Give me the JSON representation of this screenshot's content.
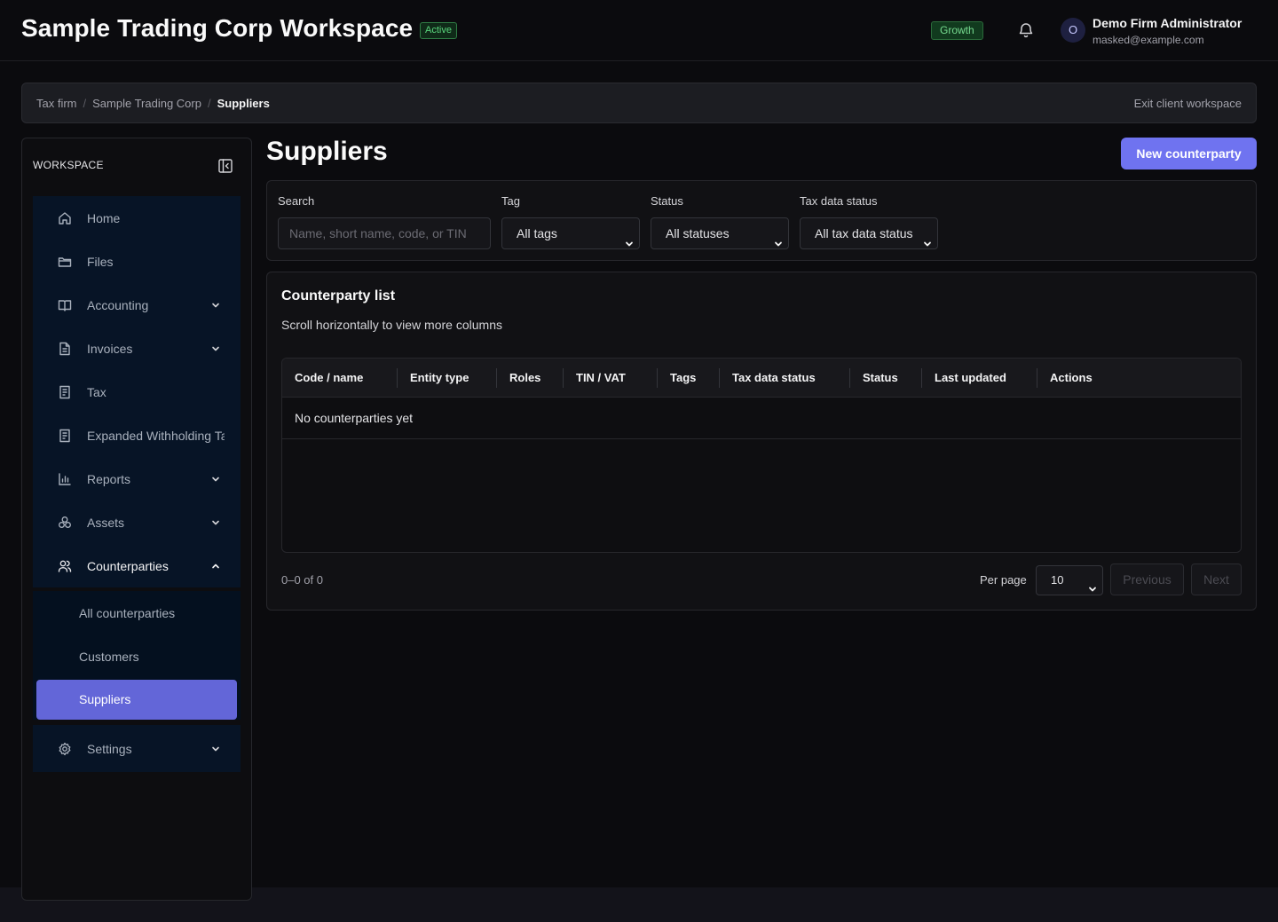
{
  "header": {
    "workspace_title": "Sample Trading Corp Workspace",
    "status_badge": "Active",
    "plan_badge": "Growth",
    "user": {
      "avatar_initial": "O",
      "name": "Demo Firm Administrator",
      "email": "masked@example.com"
    },
    "colors": {
      "status_badge": "#5ad67d",
      "plan_badge": "#76d98f"
    }
  },
  "breadcrumb": {
    "items": [
      "Tax firm",
      "Sample Trading Corp",
      "Suppliers"
    ],
    "separator": "/",
    "exit_label": "Exit client workspace"
  },
  "sidebar": {
    "heading": "WORKSPACE",
    "items": [
      {
        "label": "Home",
        "icon": "home-icon"
      },
      {
        "label": "Files",
        "icon": "folder-icon"
      },
      {
        "label": "Accounting",
        "icon": "book-icon",
        "has_children": true
      },
      {
        "label": "Invoices",
        "icon": "document-icon",
        "has_children": true
      },
      {
        "label": "Tax",
        "icon": "receipt-icon"
      },
      {
        "label": "Expanded Withholding Tax",
        "icon": "receipt-icon"
      },
      {
        "label": "Reports",
        "icon": "bar-chart-icon",
        "has_children": true
      },
      {
        "label": "Assets",
        "icon": "cubes-icon",
        "has_children": true
      },
      {
        "label": "Counterparties",
        "icon": "users-icon",
        "has_children": true,
        "expanded": true
      },
      {
        "label": "Settings",
        "icon": "gear-icon",
        "has_children": true
      }
    ],
    "counterparties_children": [
      {
        "label": "All counterparties"
      },
      {
        "label": "Customers"
      },
      {
        "label": "Suppliers",
        "active": true
      }
    ],
    "colors": {
      "active": "#6366d8"
    }
  },
  "main": {
    "title": "Suppliers",
    "new_button": "New counterparty",
    "filters": {
      "search": {
        "label": "Search",
        "placeholder": "Name, short name, code, or TIN",
        "value": ""
      },
      "tag": {
        "label": "Tag",
        "value": "All tags"
      },
      "status": {
        "label": "Status",
        "value": "All statuses"
      },
      "tax_status": {
        "label": "Tax data status",
        "value": "All tax data status"
      }
    },
    "list": {
      "title": "Counterparty list",
      "hint": "Scroll horizontally to view more columns",
      "columns": [
        "Code / name",
        "Entity type",
        "Roles",
        "TIN / VAT",
        "Tags",
        "Tax data status",
        "Status",
        "Last updated",
        "Actions"
      ],
      "empty_message": "No counterparties yet"
    },
    "pagination": {
      "range": "0–0 of 0",
      "per_page_label": "Per page",
      "per_page_value": "10",
      "previous": "Previous",
      "next": "Next"
    },
    "colors": {
      "primary": "#6f73f0"
    }
  }
}
